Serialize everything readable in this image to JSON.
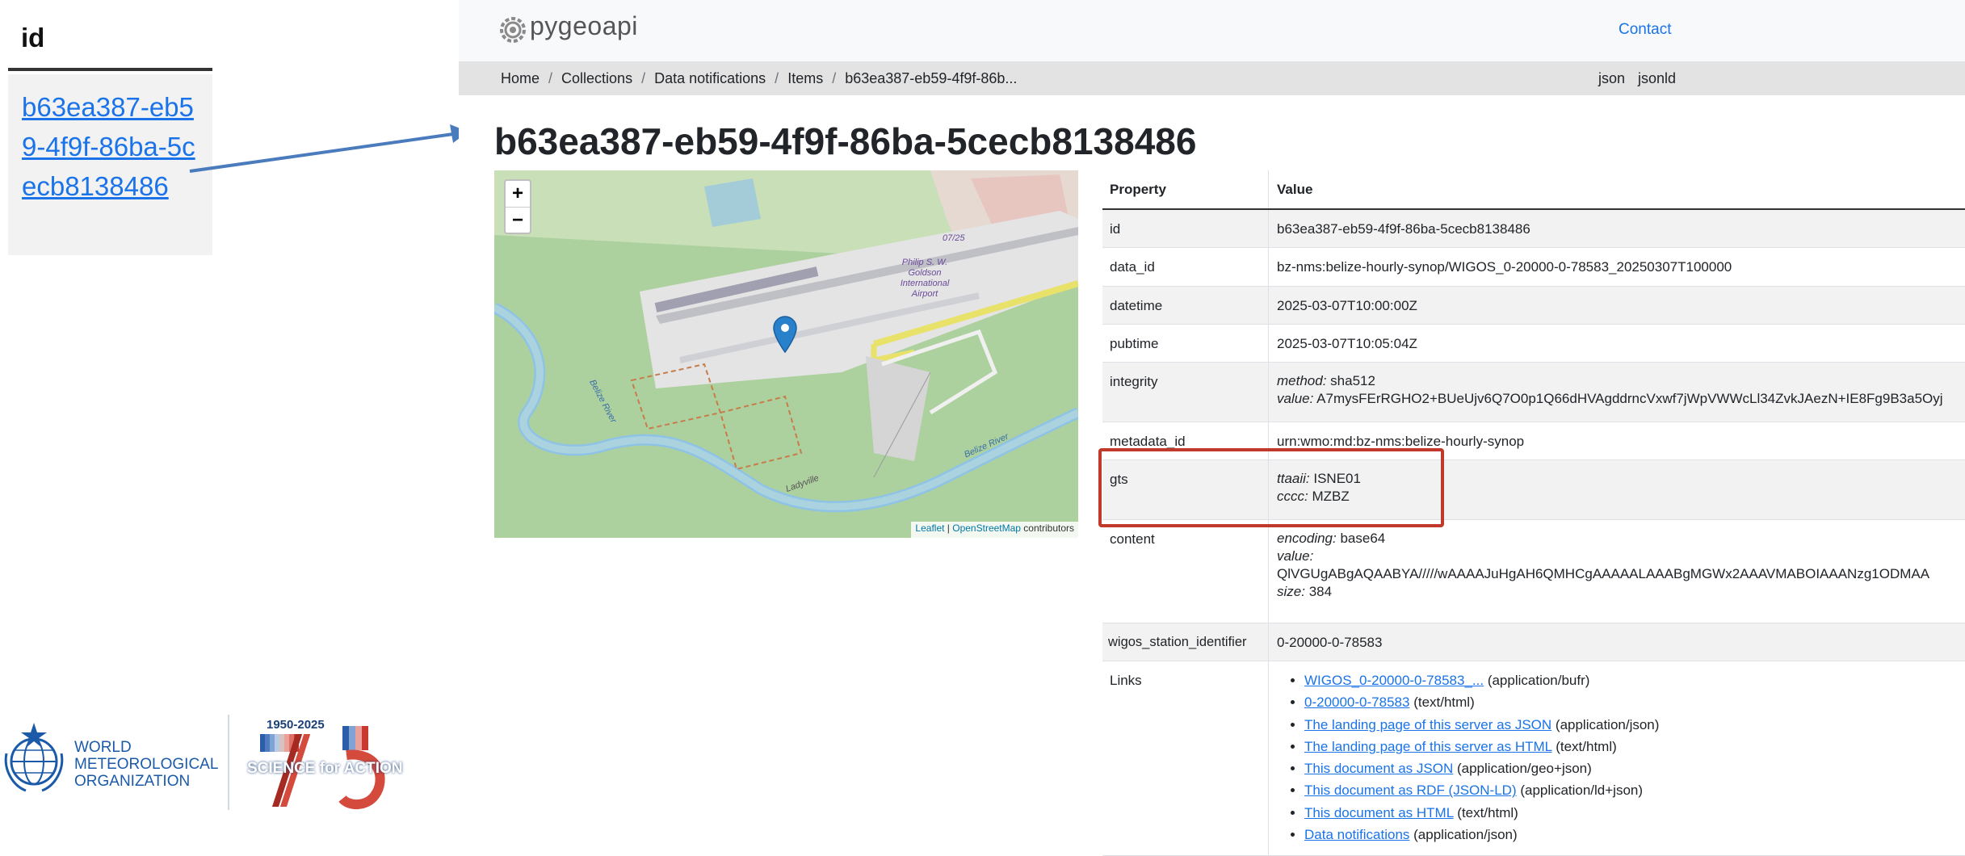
{
  "id_snippet": {
    "header": "id",
    "value": "b63ea387-eb59-4f9f-86ba-5cecb8138486"
  },
  "navbar": {
    "logo_text": "pygeoapi",
    "contact": "Contact"
  },
  "breadcrumb": {
    "items": [
      "Home",
      "Collections",
      "Data notifications",
      "Items",
      "b63ea387-eb59-4f9f-86b..."
    ],
    "formats": [
      "json",
      "jsonld"
    ]
  },
  "item": {
    "title": "b63ea387-eb59-4f9f-86ba-5cecb8138486"
  },
  "map": {
    "zoom_in": "+",
    "zoom_out": "−",
    "attribution_leaflet": "Leaflet",
    "attribution_sep": " | ",
    "attribution_osm": "OpenStreetMap",
    "attribution_suffix": " contributors",
    "label_runway": "07/25",
    "label_airport": "Philip S. W. Goldson International Airport",
    "label_river1": "Belize River",
    "label_river2": "Belize River",
    "label_ladyville": "Ladyville"
  },
  "table": {
    "header_property": "Property",
    "header_value": "Value",
    "rows": {
      "id": {
        "key": "id",
        "value": "b63ea387-eb59-4f9f-86ba-5cecb8138486"
      },
      "data_id": {
        "key": "data_id",
        "value": "bz-nms:belize-hourly-synop/WIGOS_0-20000-0-78583_20250307T100000"
      },
      "datetime": {
        "key": "datetime",
        "value": "2025-03-07T10:00:00Z"
      },
      "pubtime": {
        "key": "pubtime",
        "value": "2025-03-07T10:05:04Z"
      },
      "integrity": {
        "key": "integrity",
        "method_label": "method:",
        "method": "sha512",
        "value_label": "value:",
        "value": "A7mysFErRGHO2+BUeUjv6Q7O0p1Q66dHVAgddrncVxwf7jWpVWWcLl34ZvkJAezN+IE8Fg9B3a5Oyj"
      },
      "metadata_id": {
        "key": "metadata_id",
        "value": "urn:wmo:md:bz-nms:belize-hourly-synop"
      },
      "gts": {
        "key": "gts",
        "ttaaii_label": "ttaaii:",
        "ttaaii": "ISNE01",
        "cccc_label": "cccc:",
        "cccc": "MZBZ"
      },
      "content": {
        "key": "content",
        "encoding_label": "encoding:",
        "encoding": "base64",
        "value_label": "value:",
        "value": "QlVGUgABgAQAABYA/////wAAAAJuHgAH6QMHCgAAAAALAAABgMGWx2AAAVMABOIAAANzg1ODMAA",
        "size_label": "size:",
        "size": "384"
      },
      "wigos": {
        "key": "wigos_station_identifier",
        "value": "0-20000-0-78583"
      },
      "links": {
        "key": "Links",
        "items": [
          {
            "text": "WIGOS_0-20000-0-78583_...",
            "type": "(application/bufr)"
          },
          {
            "text": "0-20000-0-78583",
            "type": "(text/html)"
          },
          {
            "text": "The landing page of this server as JSON",
            "type": "(application/json)"
          },
          {
            "text": "The landing page of this server as HTML",
            "type": "(text/html)"
          },
          {
            "text": "This document as JSON",
            "type": "(application/geo+json)"
          },
          {
            "text": "This document as RDF (JSON-LD)",
            "type": "(application/ld+json)"
          },
          {
            "text": "This document as HTML",
            "type": "(text/html)"
          },
          {
            "text": "Data notifications",
            "type": "(application/json)"
          }
        ]
      }
    }
  },
  "wmo_logo": {
    "line1": "WORLD",
    "line2": "METEOROLOGICAL",
    "line3": "ORGANIZATION",
    "years": "1950-2025",
    "slogan": "SCIENCE for ACTION"
  },
  "colors": {
    "link": "#1a73e8",
    "highlight": "#c0392b",
    "arrow": "#4a7bbd",
    "map_pin": "#2a81cb"
  }
}
